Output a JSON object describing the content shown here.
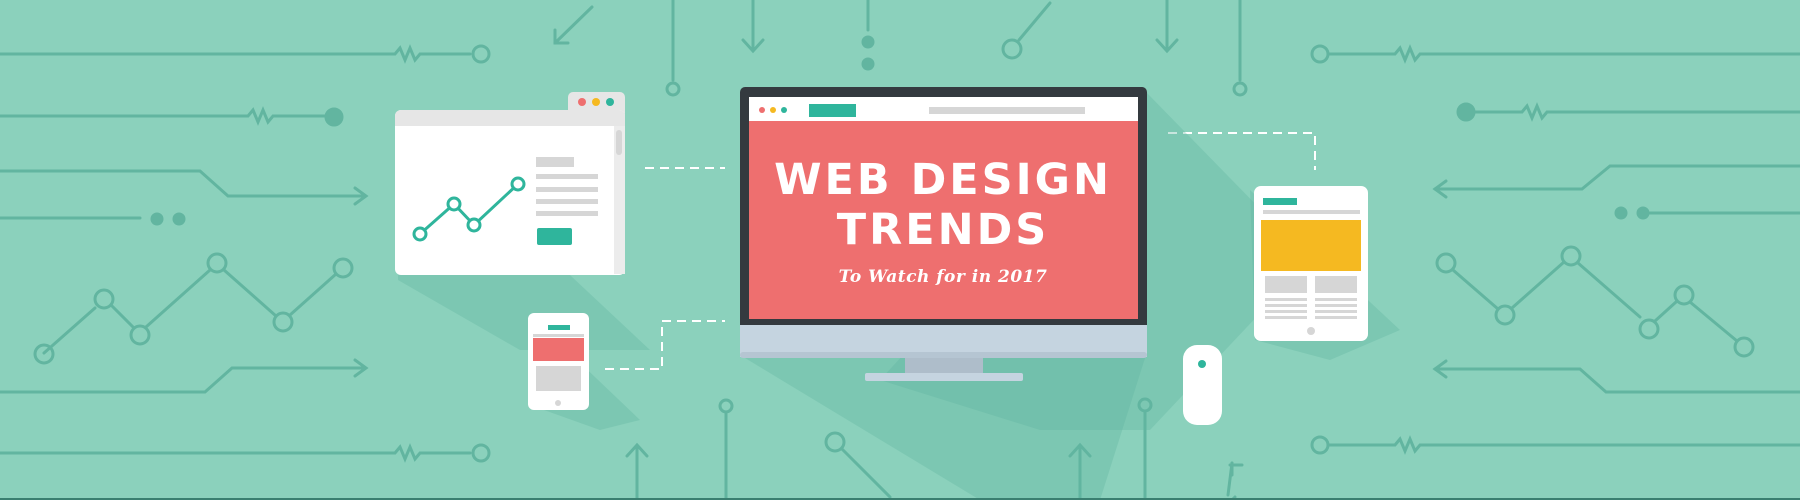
{
  "colors": {
    "background": "#8bd1bc",
    "circuit": "#62b5a0",
    "accent_teal": "#2fb59c",
    "screen_coral": "#ee6f6f",
    "monitor_frame": "#343a3f",
    "monitor_stand": "#c5d4e0",
    "tablet_yellow": "#f5b921",
    "device_white": "#ffffff",
    "placeholder_gray": "#d6d6d6",
    "dot_red": "#ee6f6f",
    "dot_orange": "#f5b921",
    "dot_green": "#2fb59c"
  },
  "hero": {
    "title_line1": "WEB DESIGN",
    "title_line2": "TRENDS",
    "subtitle": "To Watch for in 2017"
  },
  "icons": {
    "browser_window": "browser-window-icon",
    "line_chart": "line-chart-icon",
    "desktop_monitor": "desktop-monitor-icon",
    "smartphone": "smartphone-icon",
    "tablet": "tablet-icon",
    "mouse": "mouse-icon",
    "circuit_background": "circuit-pattern"
  }
}
